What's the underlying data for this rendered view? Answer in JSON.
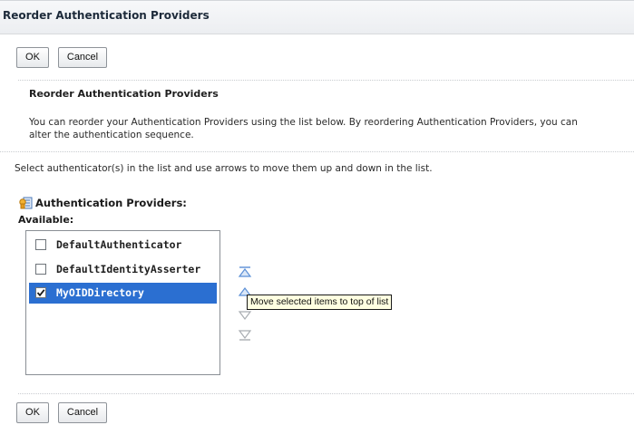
{
  "window": {
    "title": "Reorder Authentication Providers"
  },
  "toolbar_top": {
    "ok_label": "OK",
    "cancel_label": "Cancel"
  },
  "section": {
    "heading": "Reorder Authentication Providers",
    "description_line1": "You can reorder your Authentication Providers using the list below. By reordering Authentication Providers, you can",
    "description_line2": "alter the authentication sequence.",
    "instruction": "Select authenticator(s) in the list and use arrows to move them up and down in the list."
  },
  "providers": {
    "label": "Authentication Providers:",
    "icon": "authentication-providers-icon",
    "available_label": "Available:",
    "items": [
      {
        "name": "DefaultAuthenticator",
        "checked": false
      },
      {
        "name": "DefaultIdentityAsserter",
        "checked": false
      },
      {
        "name": "MyOIDDirectory",
        "checked": true
      }
    ]
  },
  "arrows": {
    "icons": [
      "move-to-top-icon",
      "move-up-icon",
      "move-down-icon",
      "move-to-bottom-icon"
    ],
    "tooltip": "Move selected items to top of list"
  },
  "toolbar_bottom": {
    "ok_label": "OK",
    "cancel_label": "Cancel"
  },
  "colors": {
    "selection": "#2b6fd1",
    "arrow": "#5b8fd6",
    "arrow_disabled": "#a9adb2",
    "tooltip_bg": "#ffffe1"
  }
}
